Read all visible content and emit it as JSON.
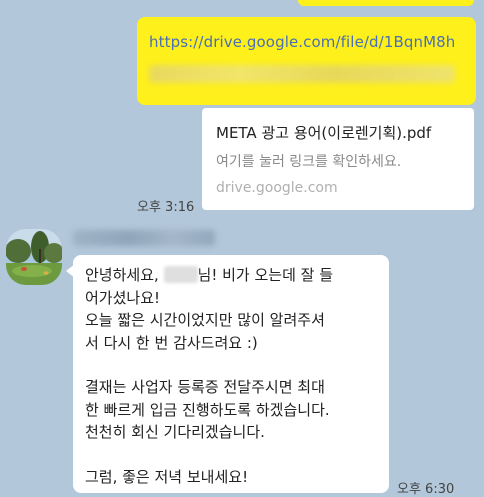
{
  "sent": {
    "url": "https://drive.google.com/file/d/1BqnM8h",
    "time": "오후 3:16"
  },
  "preview": {
    "title": "META 광고 용어(이로렌기획).pdf",
    "description": "여기를 눌러 링크를 확인하세요.",
    "domain": "drive.google.com"
  },
  "received": {
    "greeting_before": "안녕하세요, ",
    "greeting_after": "님! 비가 오는데 잘 들",
    "lines": [
      "어가셨나요!",
      "오늘 짧은 시간이었지만 많이 알려주셔",
      "서 다시 한 번 감사드려요 :)"
    ],
    "lines2": [
      "결재는 사업자 등록증 전달주시면 최대",
      "한 빠르게 입금 진행하도록 하겠습니다.",
      "천천히 회신 기다리겠습니다."
    ],
    "closing": "그럼, 좋은 저녁 보내세요!",
    "time": "오후 6:30"
  },
  "colors": {
    "background": "#b2c7d9",
    "sent_bubble": "#fef01b",
    "received_bubble": "#ffffff",
    "link": "#4a6fb5"
  }
}
